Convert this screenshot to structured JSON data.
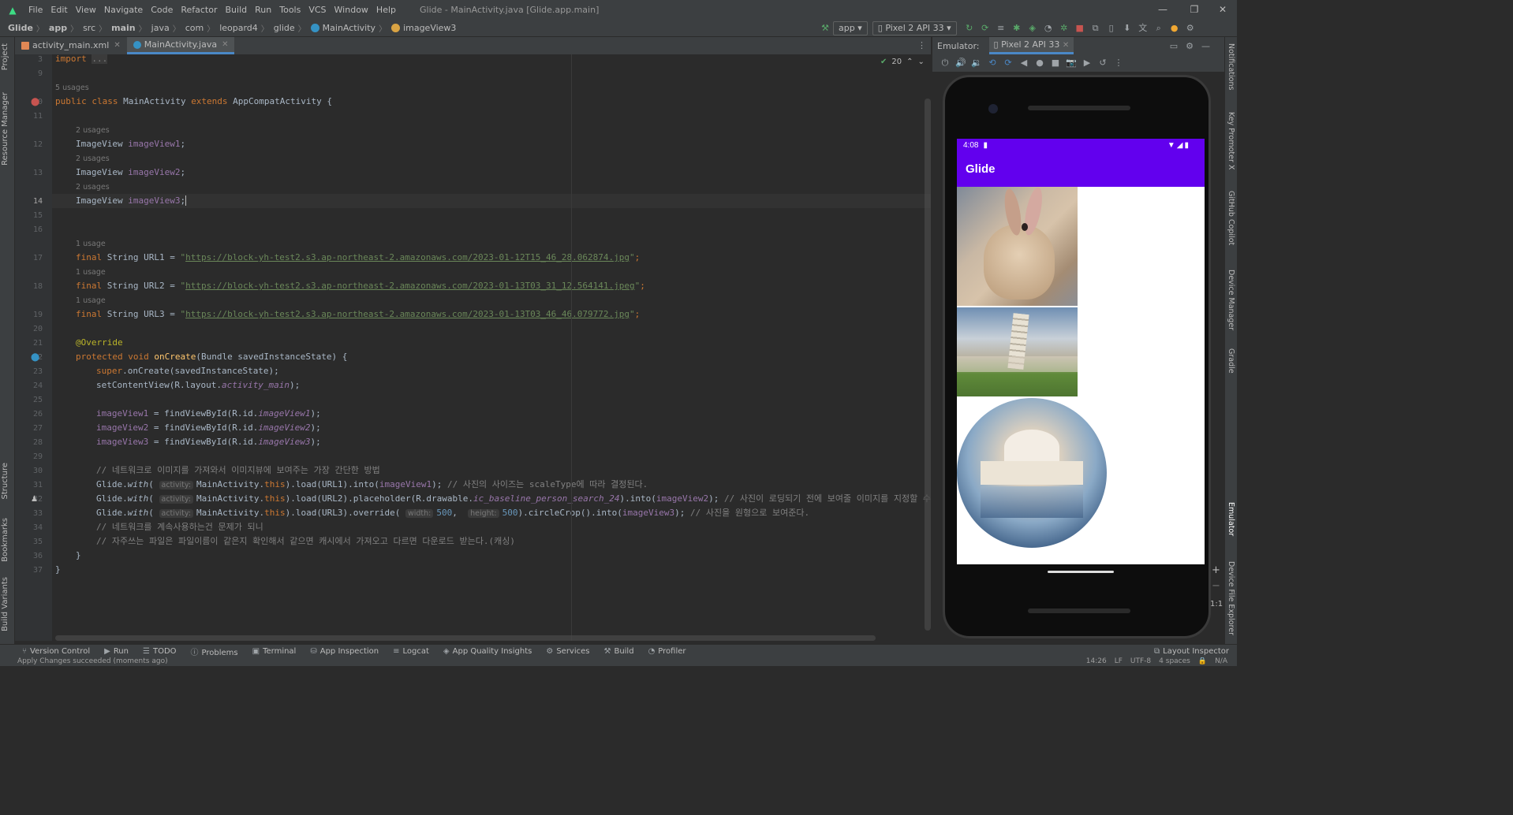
{
  "menu": {
    "items": [
      "File",
      "Edit",
      "View",
      "Navigate",
      "Code",
      "Refactor",
      "Build",
      "Run",
      "Tools",
      "VCS",
      "Window",
      "Help"
    ],
    "title": "Glide - MainActivity.java [Glide.app.main]"
  },
  "breadcrumb": {
    "items": [
      "Glide",
      "app",
      "src",
      "main",
      "java",
      "com",
      "leopard4",
      "glide",
      "MainActivity",
      "imageView3"
    ]
  },
  "toolbar": {
    "config": "app",
    "device": "Pixel 2 API 33"
  },
  "tabs": [
    {
      "label": "activity_main.xml"
    },
    {
      "label": "MainActivity.java"
    }
  ],
  "editor": {
    "problems_count": "20",
    "line_numbers": [
      "3",
      "9",
      "10",
      "11",
      "12",
      "13",
      "14",
      "15",
      "16",
      "17",
      "18",
      "19",
      "20",
      "21",
      "22",
      "23",
      "24",
      "25",
      "26",
      "27",
      "28",
      "29",
      "30",
      "31",
      "32",
      "33",
      "34",
      "35",
      "36",
      "37"
    ],
    "usages": {
      "u5": "5 usages",
      "u2a": "2 usages",
      "u2b": "2 usages",
      "u2c": "2 usages",
      "u1a": "1 usage",
      "u1b": "1 usage",
      "u1c": "1 usage"
    },
    "code": {
      "l3_kw": "import",
      "l3_dots": "...",
      "l10_a": "public class ",
      "l10_b": "MainActivity ",
      "l10_c": "extends ",
      "l10_d": "AppCompatActivity {",
      "l12_a": "ImageView ",
      "l12_b": "imageView1",
      "l13_b": "imageView2",
      "l14_b": "imageView3",
      "l17_a": "final ",
      "l17_b": "String URL1 = ",
      "l17_url": "https://block-yh-test2.s3.ap-northeast-2.amazonaws.com/2023-01-12T15_46_28.062874.jpg",
      "l18_b": "String URL2 = ",
      "l18_url": "https://block-yh-test2.s3.ap-northeast-2.amazonaws.com/2023-01-13T03_31_12.564141.jpeg",
      "l19_b": "String URL3 = ",
      "l19_url": "https://block-yh-test2.s3.ap-northeast-2.amazonaws.com/2023-01-13T03_46_46.079772.jpg",
      "l21": "@Override",
      "l22_a": "protected void ",
      "l22_b": "onCreate",
      "l22_c": "(Bundle savedInstanceState) {",
      "l23_a": "super",
      "l23_b": ".onCreate(savedInstanceState);",
      "l24_a": "setContentView(R.layout.",
      "l24_b": "activity_main",
      "l24_c": ");",
      "l26_a": "imageView1",
      "l26_b": " = findViewById(R.id.",
      "l26_c": "imageView1",
      "l27_a": "imageView2",
      "l27_c": "imageView2",
      "l28_a": "imageView3",
      "l28_c": "imageView3",
      "l30": "// 네트워크로 이미지를 가져와서 이미지뷰에 보여주는 가장 간단한 방법",
      "l31_a": "Glide.",
      "l31_b": "with",
      "l31_hint": "activity:",
      "l31_c": "MainActivity.",
      "l31_d": "this",
      "l31_e": ").load(URL1).into(",
      "l31_f": "imageView1",
      "l31_g": "); ",
      "l31_cmt": "// 사진의 사이즈는 scaleType에 따라 결정된다.",
      "l32_e": ").load(URL2).placeholder(R.drawable.",
      "l32_f": "ic_baseline_person_search_24",
      "l32_g": ").into(",
      "l32_h": "imageView2",
      "l32_cmt": "// 사진이 로딩되기 전에 보여줄 이미지를 지정할 수 있",
      "l33_e": ").load(URL3).override(",
      "l33_hint1": "width:",
      "l33_n1": "500",
      "l33_hint2": "height:",
      "l33_n2": "500",
      "l33_f": ").circleCrop().into(",
      "l33_g": "imageView3",
      "l33_cmt": "// 사진을 원형으로 보여준다.",
      "l34": "// 네트워크를 계속사용하는건 문제가 되니",
      "l35": "// 자주쓰는 파일은 파일이름이 같은지 확인해서 같으면 캐시에서 가져오고 다르면 다운로드 받는다.(캐싱)",
      "l36": "}",
      "l37": "}"
    }
  },
  "emulator": {
    "label": "Emulator:",
    "tab": "Pixel 2 API 33",
    "status_time": "4:08",
    "app_title": "Glide",
    "zoom": "1:1"
  },
  "left_tools": [
    "Project",
    "Resource Manager",
    "Structure",
    "Bookmarks",
    "Build Variants"
  ],
  "right_tools": [
    "Notifications",
    "Key Promoter X",
    "GitHub Copilot",
    "Device Manager",
    "Gradle",
    "Emulator",
    "Device File Explorer"
  ],
  "bottom_tools": [
    "Version Control",
    "Run",
    "TODO",
    "Problems",
    "Terminal",
    "App Inspection",
    "Logcat",
    "App Quality Insights",
    "Services",
    "Build",
    "Profiler"
  ],
  "layout_inspector": "Layout Inspector",
  "status": {
    "message": "Apply Changes succeeded (moments ago)",
    "position": "14:26",
    "line_sep": "LF",
    "encoding": "UTF-8",
    "indent": "4 spaces",
    "extra": "N/A"
  },
  "colors": {
    "accent": "#4a88c7",
    "app_bar": "#6200ee",
    "android_green": "#3ddc84"
  }
}
